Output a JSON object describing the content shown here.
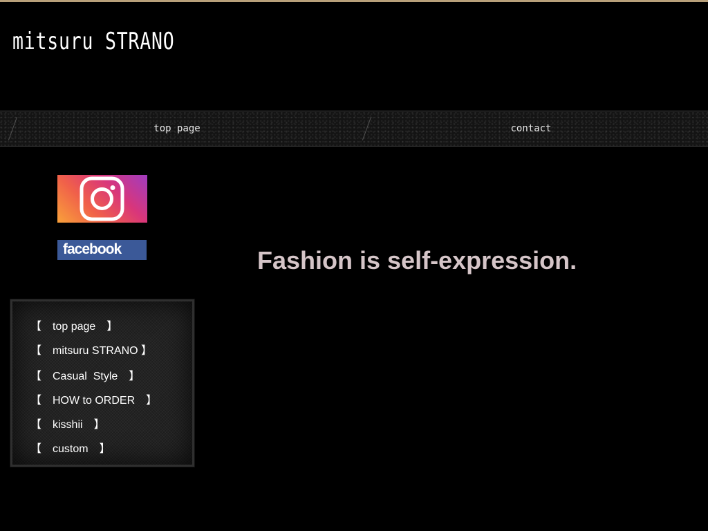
{
  "header": {
    "site_title": "mitsuru STRANO"
  },
  "nav": {
    "items": [
      {
        "label": "top page"
      },
      {
        "label": "contact"
      }
    ]
  },
  "social": {
    "instagram_icon": "instagram-icon",
    "facebook_label": "facebook"
  },
  "sidebar": {
    "menu": [
      {
        "label": "【　top page　】"
      },
      {
        "label": "【　mitsuru STRANO 】"
      },
      {
        "label": "【　Casual  Style　】"
      },
      {
        "label": "【　HOW to ORDER　】"
      },
      {
        "label": "【　kisshii　】"
      },
      {
        "label": "【　custom　】"
      }
    ]
  },
  "main": {
    "tagline": "Fashion is self-expression."
  },
  "colors": {
    "accent_bar": "#b8a07a",
    "tagline": "#d5c5c8",
    "facebook": "#3b5998"
  }
}
